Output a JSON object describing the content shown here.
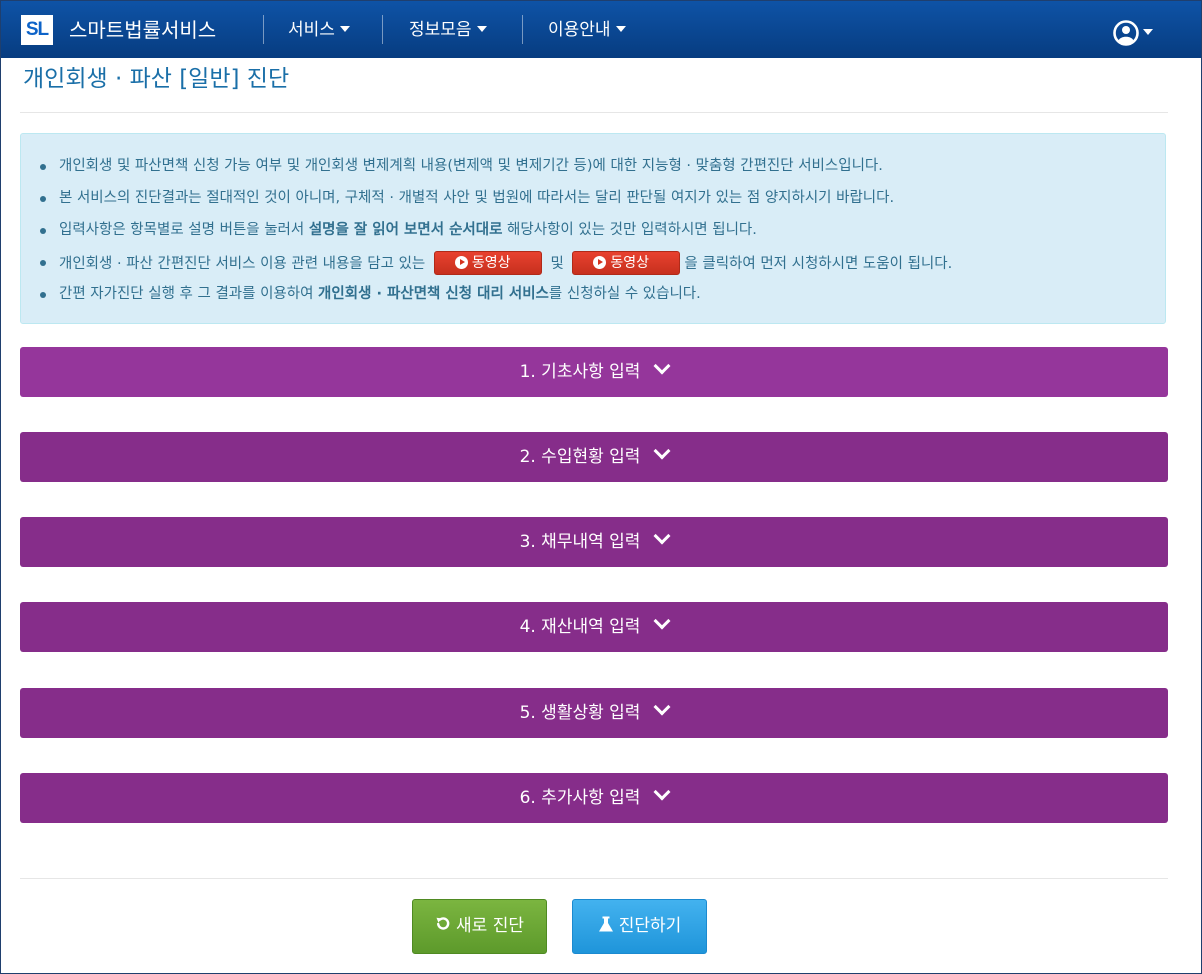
{
  "navbar": {
    "logo_text": "SL",
    "brand": "스마트법률서비스",
    "menus": [
      {
        "label": "서비스"
      },
      {
        "label": "정보모음"
      },
      {
        "label": "이용안내"
      }
    ],
    "user_icon": "user-circle-icon"
  },
  "page": {
    "title": "개인회생 · 파산 [일반] 진단"
  },
  "info": {
    "item1": "개인회생 및 파산면책 신청 가능 여부 및 개인회생 변제계획 내용(변제액 및 변제기간 등)에 대한 지능형 · 맞춤형 간편진단 서비스입니다.",
    "item2": "본 서비스의 진단결과는 절대적인 것이 아니며, 구체적 · 개별적 사안 및 법원에 따라서는 달리 판단될 여지가 있는 점 양지하시기 바랍니다.",
    "item3_a": "입력사항은 항목별로 설명 버튼을 눌러서 ",
    "item3_b": "설명을 잘 읽어 보면서 순서대로",
    "item3_c": " 해당사항이 있는 것만 입력하시면 됩니다.",
    "item4_a": "개인회생 · 파산 간편진단 서비스 이용 관련 내용을 담고 있는",
    "video_label": "동영상",
    "item4_b": "및",
    "item4_c": "을 클릭하여 먼저 시청하시면 도움이 됩니다.",
    "item5_a": "간편 자가진단 실행 후 그 결과를 이용하여 ",
    "item5_b": "개인회생 · 파산면책 신청 대리 서비스",
    "item5_c": "를 신청하실 수 있습니다."
  },
  "sections": [
    {
      "label": "1. 기초사항 입력"
    },
    {
      "label": "2. 수입현황 입력"
    },
    {
      "label": "3. 채무내역 입력"
    },
    {
      "label": "4. 재산내역 입력"
    },
    {
      "label": "5. 생활상황 입력"
    },
    {
      "label": "6. 추가사항 입력"
    }
  ],
  "actions": {
    "reset_label": "새로 진단",
    "diagnose_label": "진단하기"
  },
  "colors": {
    "navbar": "#0a4a95",
    "section": "#862d8a",
    "reset_button": "#6aa835",
    "diagnose_button": "#2aa2e6",
    "video_button": "#d93a27"
  }
}
